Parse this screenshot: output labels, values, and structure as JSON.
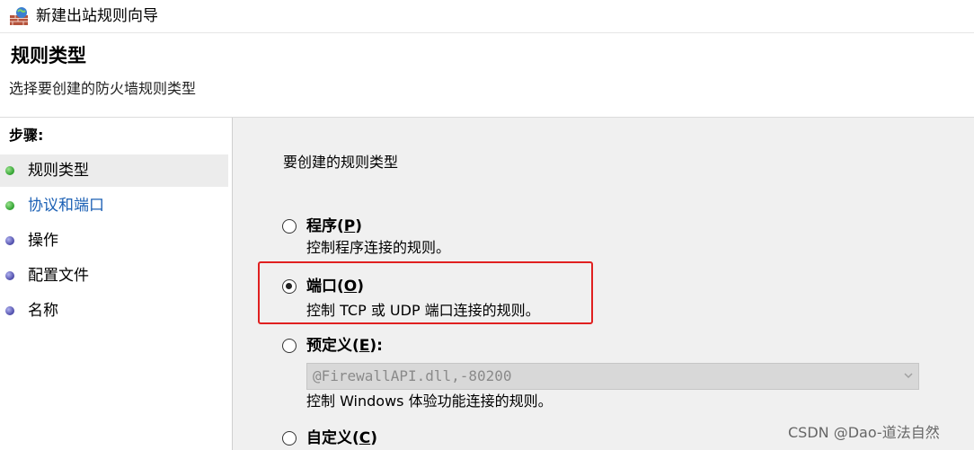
{
  "window": {
    "title": "新建出站规则向导",
    "icon": "firewall-icon"
  },
  "header": {
    "title": "规则类型",
    "subtitle": "选择要创建的防火墙规则类型"
  },
  "steps": {
    "heading": "步骤:",
    "items": [
      {
        "label": "规则类型",
        "status": "green",
        "active": true
      },
      {
        "label": "协议和端口",
        "status": "green",
        "link": true
      },
      {
        "label": "操作",
        "status": "purple"
      },
      {
        "label": "配置文件",
        "status": "purple"
      },
      {
        "label": "名称",
        "status": "purple"
      }
    ]
  },
  "main": {
    "heading": "要创建的规则类型",
    "options": {
      "program": {
        "label": "程序(",
        "key": "P",
        "tail": ")",
        "desc": "控制程序连接的规则。",
        "checked": false
      },
      "port": {
        "label": "端口(",
        "key": "O",
        "tail": ")",
        "desc": "控制 TCP 或 UDP 端口连接的规则。",
        "checked": true
      },
      "predefined": {
        "label": "预定义(",
        "key": "E",
        "tail": "):",
        "dropdown_value": "@FirewallAPI.dll,-80200",
        "desc": "控制 Windows 体验功能连接的规则。",
        "checked": false
      },
      "custom": {
        "label": "自定义(",
        "key": "C",
        "tail": ")",
        "checked": false
      }
    }
  },
  "watermark": "CSDN @Dao-道法自然",
  "colors": {
    "highlight_box": "#e02020",
    "main_bg": "#f0f0f0",
    "link_text": "#1a5fb4"
  }
}
